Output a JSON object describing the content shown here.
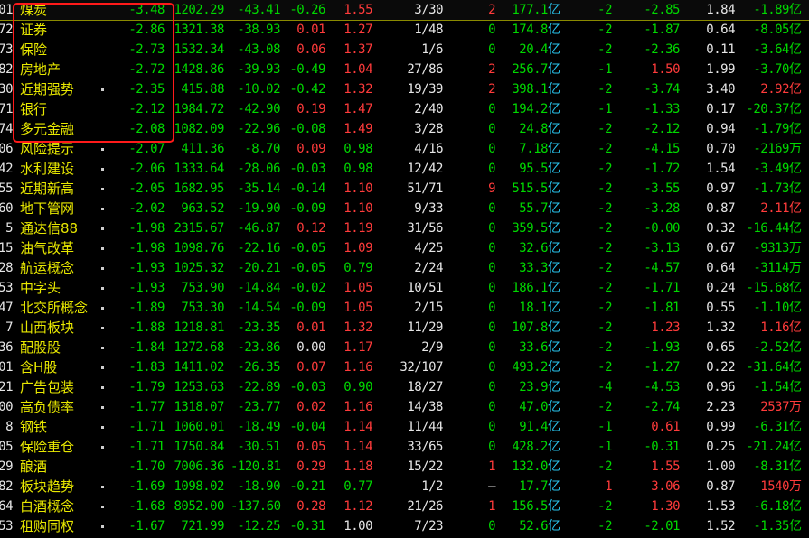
{
  "colors": {
    "up": "#ff3b3b",
    "down": "#00d800",
    "flat": "#e6e6e6",
    "unit": "#29c6f0",
    "name": "#e8e800",
    "highlight": "#ff1a1a"
  },
  "rows": [
    {
      "code": "01",
      "name": "煤炭",
      "dot": false,
      "chg": "-3.48",
      "price": "1202.29",
      "diff": "-43.41",
      "speed": "-0.26",
      "ratio": "1.55",
      "updown": "3/30",
      "lead": "2",
      "amount": "177.1",
      "unit": "亿",
      "col10": "-2",
      "col11": "-2.85",
      "col12": "1.84",
      "col13": "-1.89",
      "col13unit": "亿",
      "dirs": {
        "speed": "g",
        "ratio": "r",
        "lead": "r",
        "col11": "g",
        "col13": "g"
      }
    },
    {
      "code": "72",
      "name": "证券",
      "dot": false,
      "chg": "-2.86",
      "price": "1321.38",
      "diff": "-38.93",
      "speed": "0.01",
      "ratio": "1.27",
      "updown": "1/48",
      "lead": "0",
      "amount": "174.8",
      "unit": "亿",
      "col10": "-2",
      "col11": "-1.87",
      "col12": "0.64",
      "col13": "-8.05",
      "col13unit": "亿",
      "dirs": {
        "speed": "r",
        "ratio": "r",
        "lead": "g",
        "col11": "g",
        "col13": "g"
      }
    },
    {
      "code": "73",
      "name": "保险",
      "dot": false,
      "chg": "-2.73",
      "price": "1532.34",
      "diff": "-43.08",
      "speed": "0.06",
      "ratio": "1.37",
      "updown": "1/6",
      "lead": "0",
      "amount": "20.4",
      "unit": "亿",
      "col10": "-2",
      "col11": "-2.36",
      "col12": "0.11",
      "col13": "-3.64",
      "col13unit": "亿",
      "dirs": {
        "speed": "r",
        "ratio": "r",
        "lead": "g",
        "col11": "g",
        "col13": "g"
      }
    },
    {
      "code": "82",
      "name": "房地产",
      "dot": false,
      "chg": "-2.72",
      "price": "1428.86",
      "diff": "-39.93",
      "speed": "-0.49",
      "ratio": "1.04",
      "updown": "27/86",
      "lead": "2",
      "amount": "256.7",
      "unit": "亿",
      "col10": "-1",
      "col11": "1.50",
      "col12": "1.99",
      "col13": "-3.70",
      "col13unit": "亿",
      "dirs": {
        "speed": "g",
        "ratio": "r",
        "lead": "r",
        "col11": "r",
        "col13": "g"
      }
    },
    {
      "code": "30",
      "name": "近期强势",
      "dot": true,
      "chg": "-2.35",
      "price": "415.88",
      "diff": "-10.02",
      "speed": "-0.42",
      "ratio": "1.32",
      "updown": "19/39",
      "lead": "2",
      "amount": "398.1",
      "unit": "亿",
      "col10": "-2",
      "col11": "-3.74",
      "col12": "3.40",
      "col13": "2.92",
      "col13unit": "亿",
      "dirs": {
        "speed": "g",
        "ratio": "r",
        "lead": "r",
        "col11": "g",
        "col13": "r"
      }
    },
    {
      "code": "71",
      "name": "银行",
      "dot": false,
      "chg": "-2.12",
      "price": "1984.72",
      "diff": "-42.90",
      "speed": "0.19",
      "ratio": "1.47",
      "updown": "2/40",
      "lead": "0",
      "amount": "194.2",
      "unit": "亿",
      "col10": "-1",
      "col11": "-1.33",
      "col12": "0.17",
      "col13": "-20.37",
      "col13unit": "亿",
      "dirs": {
        "speed": "r",
        "ratio": "r",
        "lead": "g",
        "col11": "g",
        "col13": "g"
      }
    },
    {
      "code": "74",
      "name": "多元金融",
      "dot": false,
      "chg": "-2.08",
      "price": "1082.09",
      "diff": "-22.96",
      "speed": "-0.08",
      "ratio": "1.49",
      "updown": "3/28",
      "lead": "0",
      "amount": "24.8",
      "unit": "亿",
      "col10": "-2",
      "col11": "-2.12",
      "col12": "0.94",
      "col13": "-1.79",
      "col13unit": "亿",
      "dirs": {
        "speed": "g",
        "ratio": "r",
        "lead": "g",
        "col11": "g",
        "col13": "g"
      }
    },
    {
      "code": "06",
      "name": "风险提示",
      "dot": true,
      "chg": "-2.07",
      "price": "411.36",
      "diff": "-8.70",
      "speed": "0.09",
      "ratio": "0.98",
      "updown": "4/16",
      "lead": "0",
      "amount": "7.18",
      "unit": "亿",
      "col10": "-2",
      "col11": "-4.15",
      "col12": "0.70",
      "col13": "-2169",
      "col13unit": "万",
      "dirs": {
        "speed": "r",
        "ratio": "g",
        "lead": "g",
        "col11": "g",
        "col13": "g"
      }
    },
    {
      "code": "42",
      "name": "水利建设",
      "dot": true,
      "chg": "-2.06",
      "price": "1333.64",
      "diff": "-28.06",
      "speed": "-0.03",
      "ratio": "0.98",
      "updown": "12/42",
      "lead": "0",
      "amount": "95.5",
      "unit": "亿",
      "col10": "-2",
      "col11": "-1.72",
      "col12": "1.54",
      "col13": "-3.49",
      "col13unit": "亿",
      "dirs": {
        "speed": "g",
        "ratio": "g",
        "lead": "g",
        "col11": "g",
        "col13": "g"
      }
    },
    {
      "code": "55",
      "name": "近期新高",
      "dot": true,
      "chg": "-2.05",
      "price": "1682.95",
      "diff": "-35.14",
      "speed": "-0.14",
      "ratio": "1.10",
      "updown": "51/71",
      "lead": "9",
      "amount": "515.5",
      "unit": "亿",
      "col10": "-2",
      "col11": "-3.55",
      "col12": "0.97",
      "col13": "-1.73",
      "col13unit": "亿",
      "dirs": {
        "speed": "g",
        "ratio": "r",
        "lead": "r",
        "col11": "g",
        "col13": "g"
      }
    },
    {
      "code": "60",
      "name": "地下管网",
      "dot": true,
      "chg": "-2.02",
      "price": "963.52",
      "diff": "-19.90",
      "speed": "-0.09",
      "ratio": "1.10",
      "updown": "9/33",
      "lead": "0",
      "amount": "55.7",
      "unit": "亿",
      "col10": "-2",
      "col11": "-3.28",
      "col12": "0.87",
      "col13": "2.11",
      "col13unit": "亿",
      "dirs": {
        "speed": "g",
        "ratio": "r",
        "lead": "g",
        "col11": "g",
        "col13": "r"
      }
    },
    {
      "code": "5",
      "name": "通达信88",
      "dot": true,
      "chg": "-1.98",
      "price": "2315.67",
      "diff": "-46.87",
      "speed": "0.12",
      "ratio": "1.19",
      "updown": "31/56",
      "lead": "0",
      "amount": "359.5",
      "unit": "亿",
      "col10": "-2",
      "col11": "-0.00",
      "col12": "0.32",
      "col13": "-16.44",
      "col13unit": "亿",
      "dirs": {
        "speed": "r",
        "ratio": "r",
        "lead": "g",
        "col11": "g",
        "col13": "g"
      }
    },
    {
      "code": "15",
      "name": "油气改革",
      "dot": true,
      "chg": "-1.98",
      "price": "1098.76",
      "diff": "-22.16",
      "speed": "-0.05",
      "ratio": "1.09",
      "updown": "4/25",
      "lead": "0",
      "amount": "32.6",
      "unit": "亿",
      "col10": "-2",
      "col11": "-3.13",
      "col12": "0.67",
      "col13": "-9313",
      "col13unit": "万",
      "dirs": {
        "speed": "g",
        "ratio": "r",
        "lead": "g",
        "col11": "g",
        "col13": "g"
      }
    },
    {
      "code": "28",
      "name": "航运概念",
      "dot": true,
      "chg": "-1.93",
      "price": "1025.32",
      "diff": "-20.21",
      "speed": "-0.05",
      "ratio": "0.79",
      "updown": "2/24",
      "lead": "0",
      "amount": "33.3",
      "unit": "亿",
      "col10": "-2",
      "col11": "-4.57",
      "col12": "0.64",
      "col13": "-3114",
      "col13unit": "万",
      "dirs": {
        "speed": "g",
        "ratio": "g",
        "lead": "g",
        "col11": "g",
        "col13": "g"
      }
    },
    {
      "code": "53",
      "name": "中字头",
      "dot": true,
      "chg": "-1.93",
      "price": "753.90",
      "diff": "-14.84",
      "speed": "-0.02",
      "ratio": "1.05",
      "updown": "10/51",
      "lead": "0",
      "amount": "186.1",
      "unit": "亿",
      "col10": "-2",
      "col11": "-1.71",
      "col12": "0.24",
      "col13": "-15.68",
      "col13unit": "亿",
      "dirs": {
        "speed": "g",
        "ratio": "r",
        "lead": "g",
        "col11": "g",
        "col13": "g"
      }
    },
    {
      "code": "47",
      "name": "北交所概念",
      "dot": true,
      "chg": "-1.89",
      "price": "753.30",
      "diff": "-14.54",
      "speed": "-0.09",
      "ratio": "1.05",
      "updown": "2/15",
      "lead": "0",
      "amount": "18.1",
      "unit": "亿",
      "col10": "-2",
      "col11": "-1.81",
      "col12": "0.55",
      "col13": "-1.10",
      "col13unit": "亿",
      "dirs": {
        "speed": "g",
        "ratio": "r",
        "lead": "g",
        "col11": "g",
        "col13": "g"
      }
    },
    {
      "code": "7",
      "name": "山西板块",
      "dot": true,
      "chg": "-1.88",
      "price": "1218.81",
      "diff": "-23.35",
      "speed": "0.01",
      "ratio": "1.32",
      "updown": "11/29",
      "lead": "0",
      "amount": "107.8",
      "unit": "亿",
      "col10": "-2",
      "col11": "1.23",
      "col12": "1.32",
      "col13": "1.16",
      "col13unit": "亿",
      "dirs": {
        "speed": "r",
        "ratio": "r",
        "lead": "g",
        "col11": "r",
        "col13": "r"
      }
    },
    {
      "code": "36",
      "name": "配股股",
      "dot": true,
      "chg": "-1.84",
      "price": "1272.68",
      "diff": "-23.86",
      "speed": "0.00",
      "ratio": "1.17",
      "updown": "2/9",
      "lead": "0",
      "amount": "33.6",
      "unit": "亿",
      "col10": "-2",
      "col11": "-1.93",
      "col12": "0.65",
      "col13": "-2.52",
      "col13unit": "亿",
      "dirs": {
        "speed": "w",
        "ratio": "r",
        "lead": "g",
        "col11": "g",
        "col13": "g"
      }
    },
    {
      "code": "01",
      "name": "含H股",
      "dot": true,
      "chg": "-1.83",
      "price": "1411.02",
      "diff": "-26.35",
      "speed": "0.07",
      "ratio": "1.16",
      "updown": "32/107",
      "lead": "0",
      "amount": "493.2",
      "unit": "亿",
      "col10": "-2",
      "col11": "-1.27",
      "col12": "0.22",
      "col13": "-31.64",
      "col13unit": "亿",
      "dirs": {
        "speed": "r",
        "ratio": "r",
        "lead": "g",
        "col11": "g",
        "col13": "g"
      }
    },
    {
      "code": "21",
      "name": "广告包装",
      "dot": true,
      "chg": "-1.79",
      "price": "1253.63",
      "diff": "-22.89",
      "speed": "-0.03",
      "ratio": "0.90",
      "updown": "18/27",
      "lead": "0",
      "amount": "23.9",
      "unit": "亿",
      "col10": "-4",
      "col11": "-4.53",
      "col12": "0.96",
      "col13": "-1.54",
      "col13unit": "亿",
      "dirs": {
        "speed": "g",
        "ratio": "g",
        "lead": "g",
        "col11": "g",
        "col13": "g"
      }
    },
    {
      "code": "00",
      "name": "高负债率",
      "dot": true,
      "chg": "-1.77",
      "price": "1318.07",
      "diff": "-23.77",
      "speed": "0.02",
      "ratio": "1.16",
      "updown": "14/38",
      "lead": "0",
      "amount": "47.0",
      "unit": "亿",
      "col10": "-2",
      "col11": "-2.74",
      "col12": "2.23",
      "col13": "2537",
      "col13unit": "万",
      "dirs": {
        "speed": "r",
        "ratio": "r",
        "lead": "g",
        "col11": "g",
        "col13": "r"
      }
    },
    {
      "code": "8",
      "name": "钢铁",
      "dot": true,
      "chg": "-1.71",
      "price": "1060.01",
      "diff": "-18.49",
      "speed": "-0.04",
      "ratio": "1.14",
      "updown": "11/44",
      "lead": "0",
      "amount": "91.4",
      "unit": "亿",
      "col10": "-1",
      "col11": "0.61",
      "col12": "0.99",
      "col13": "-6.31",
      "col13unit": "亿",
      "dirs": {
        "speed": "g",
        "ratio": "r",
        "lead": "g",
        "col11": "r",
        "col13": "g"
      }
    },
    {
      "code": "05",
      "name": "保险重仓",
      "dot": true,
      "chg": "-1.71",
      "price": "1750.84",
      "diff": "-30.51",
      "speed": "0.05",
      "ratio": "1.14",
      "updown": "33/65",
      "lead": "0",
      "amount": "428.2",
      "unit": "亿",
      "col10": "-1",
      "col11": "-0.31",
      "col12": "0.25",
      "col13": "-21.24",
      "col13unit": "亿",
      "dirs": {
        "speed": "r",
        "ratio": "r",
        "lead": "g",
        "col11": "g",
        "col13": "g"
      }
    },
    {
      "code": "29",
      "name": "酿酒",
      "dot": false,
      "chg": "-1.70",
      "price": "7006.36",
      "diff": "-120.81",
      "speed": "0.29",
      "ratio": "1.18",
      "updown": "15/22",
      "lead": "1",
      "amount": "132.0",
      "unit": "亿",
      "col10": "-2",
      "col11": "1.55",
      "col12": "1.00",
      "col13": "-8.31",
      "col13unit": "亿",
      "dirs": {
        "speed": "r",
        "ratio": "r",
        "lead": "r",
        "col11": "r",
        "col13": "g"
      }
    },
    {
      "code": "82",
      "name": "板块趋势",
      "dot": true,
      "chg": "-1.69",
      "price": "1098.02",
      "diff": "-18.90",
      "speed": "-0.21",
      "ratio": "0.77",
      "updown": "1/2",
      "lead": "—",
      "amount": "17.7",
      "unit": "亿",
      "col10": "1",
      "col11": "3.06",
      "col12": "0.87",
      "col13": "1540",
      "col13unit": "万",
      "dirs": {
        "speed": "g",
        "ratio": "g",
        "lead": "w",
        "col10": "r",
        "col11": "r",
        "col13": "r"
      }
    },
    {
      "code": "64",
      "name": "白酒概念",
      "dot": true,
      "chg": "-1.68",
      "price": "8052.00",
      "diff": "-137.60",
      "speed": "0.28",
      "ratio": "1.12",
      "updown": "21/26",
      "lead": "1",
      "amount": "156.5",
      "unit": "亿",
      "col10": "-2",
      "col11": "1.30",
      "col12": "1.53",
      "col13": "-6.18",
      "col13unit": "亿",
      "dirs": {
        "speed": "r",
        "ratio": "r",
        "lead": "r",
        "col11": "r",
        "col13": "g"
      }
    },
    {
      "code": "53",
      "name": "租购同权",
      "dot": true,
      "chg": "-1.67",
      "price": "721.99",
      "diff": "-12.25",
      "speed": "-0.31",
      "ratio": "1.00",
      "updown": "7/23",
      "lead": "0",
      "amount": "52.6",
      "unit": "亿",
      "col10": "-2",
      "col11": "-2.01",
      "col12": "1.52",
      "col13": "-1.35",
      "col13unit": "亿",
      "dirs": {
        "speed": "g",
        "ratio": "w",
        "lead": "g",
        "col11": "g",
        "col13": "g"
      }
    }
  ]
}
